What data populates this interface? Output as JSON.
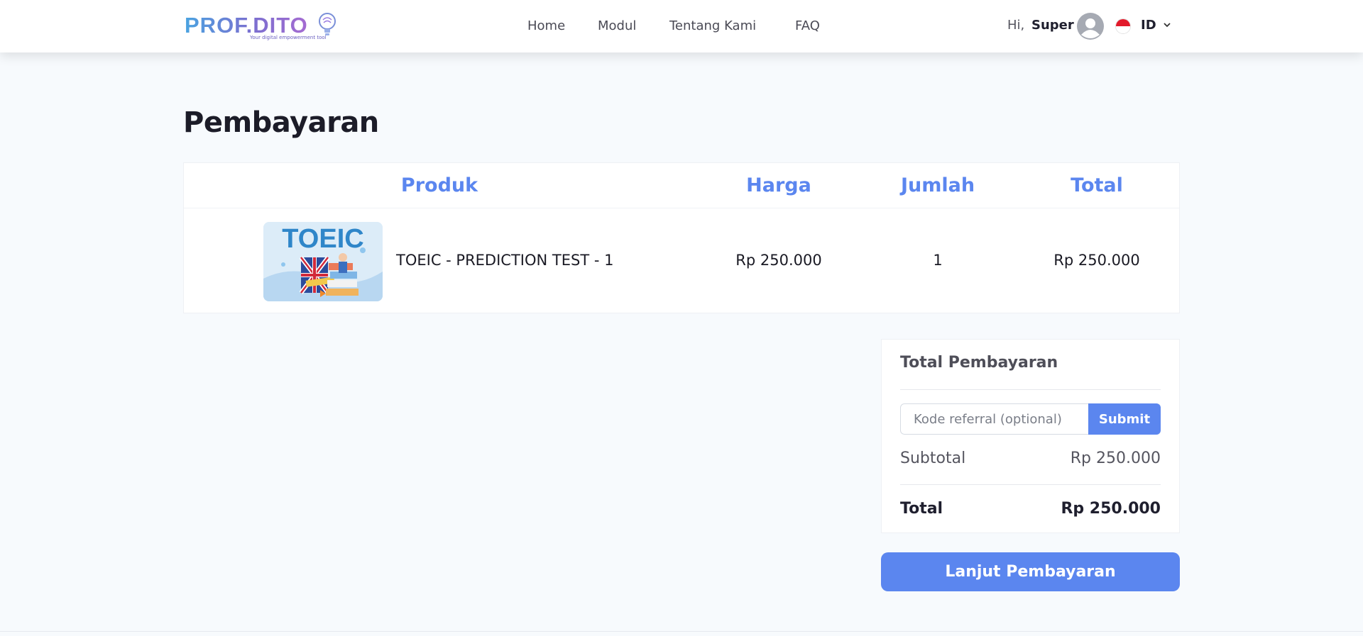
{
  "header": {
    "logo_text": "PROF.DITO",
    "logo_tagline": "Your digital empowerment tool",
    "nav": [
      {
        "label": "Home"
      },
      {
        "label": "Modul"
      },
      {
        "label": "Tentang Kami"
      },
      {
        "label": "FAQ"
      }
    ],
    "greeting": "Hi,",
    "user_name": "Super",
    "language": "ID"
  },
  "page": {
    "title": "Pembayaran"
  },
  "cart": {
    "columns": {
      "product": "Produk",
      "price": "Harga",
      "qty": "Jumlah",
      "total": "Total"
    },
    "items": [
      {
        "thumb_text": "TOEIC",
        "name": "TOEIC - PREDICTION TEST - 1",
        "price": "Rp 250.000",
        "qty": "1",
        "total": "Rp 250.000"
      }
    ]
  },
  "summary": {
    "title": "Total Pembayaran",
    "referral_placeholder": "Kode referral (optional)",
    "referral_value": "",
    "submit_label": "Submit",
    "subtotal_label": "Subtotal",
    "subtotal_value": "Rp 250.000",
    "total_label": "Total",
    "total_value": "Rp 250.000"
  },
  "actions": {
    "continue_label": "Lanjut Pembayaran"
  },
  "colors": {
    "accent": "#5b86ef",
    "background": "#f7fafd"
  }
}
